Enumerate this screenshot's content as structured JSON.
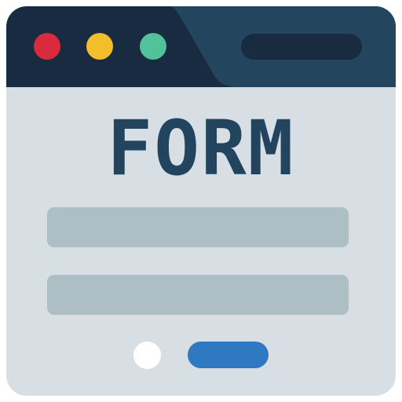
{
  "form": {
    "title": "FORM"
  },
  "icons": {
    "close": "red-circle",
    "minimize": "yellow-circle",
    "maximize": "green-circle",
    "radio": "radio-circle"
  },
  "colors": {
    "titlebar_dark": "#182b40",
    "titlebar_tab": "#24455e",
    "window_body": "#d7dfe4",
    "field": "#adbfc5",
    "title_text": "#22445e",
    "close": "#d92b3d",
    "minimize": "#f4bd2a",
    "maximize": "#51c29a",
    "submit": "#2f79c2",
    "radio": "#ffffff"
  }
}
